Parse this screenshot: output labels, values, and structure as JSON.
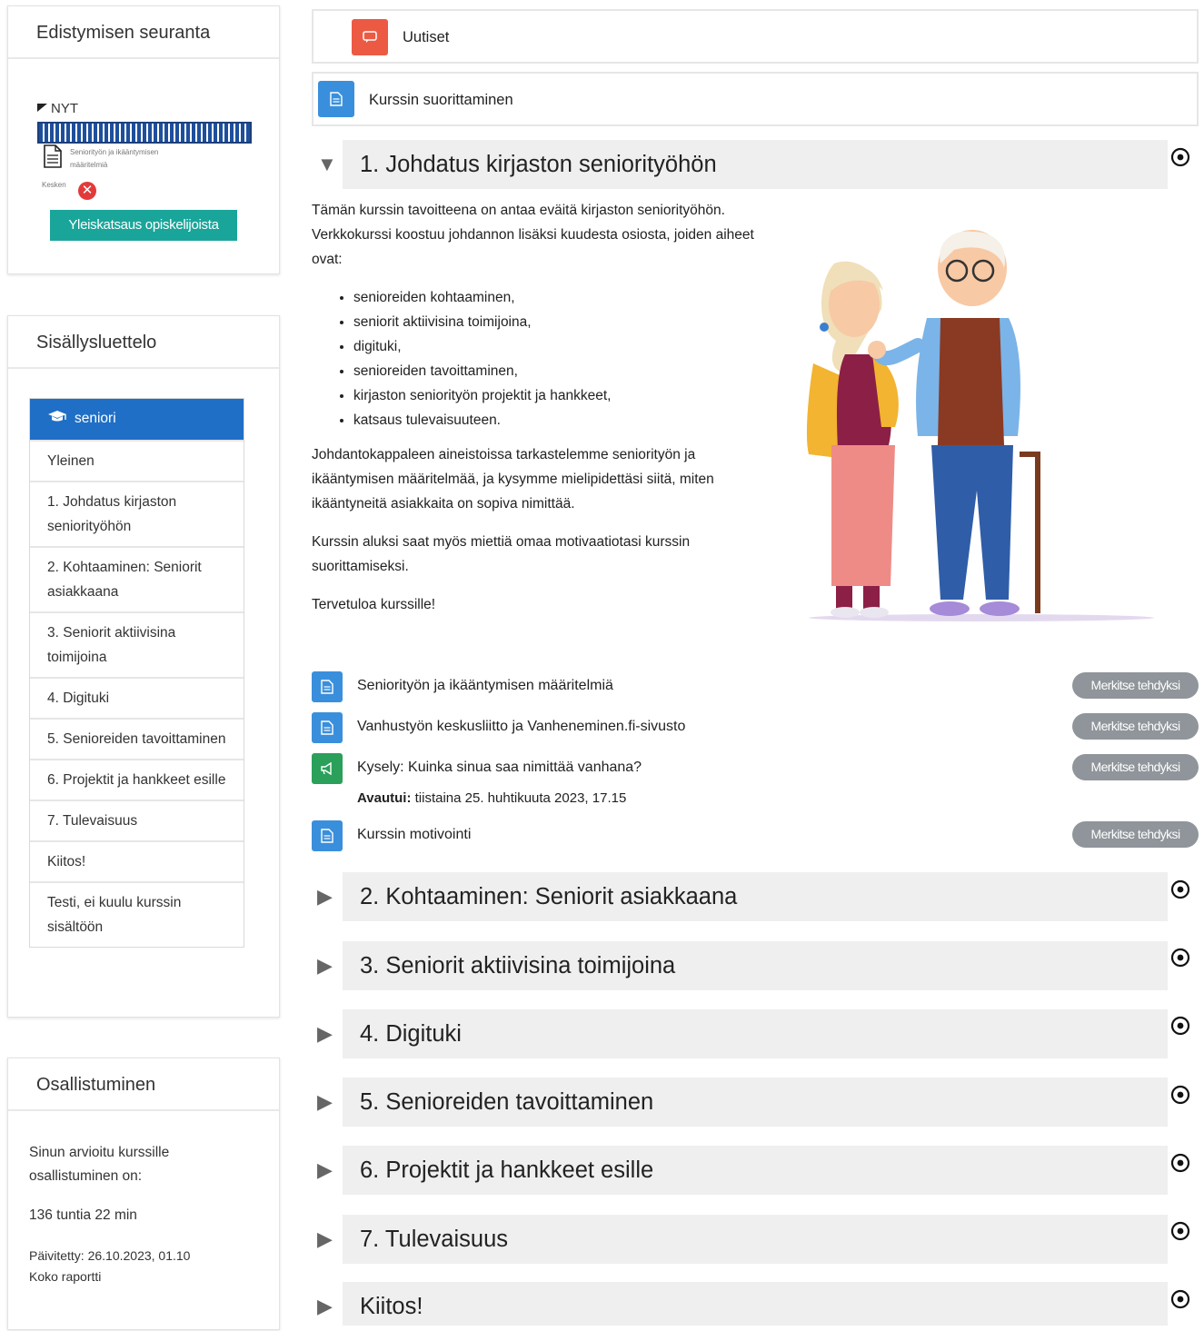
{
  "progress": {
    "title": "Edistymisen seuranta",
    "now_label": "NYT",
    "progress_fraction": 1.0,
    "item_label_line1": "Seniorityön ja ikääntymisen",
    "item_label_line2": "määritelmiä",
    "status_label": "Kesken",
    "overview_button": "Yleiskatsaus opiskelijoista"
  },
  "toc": {
    "title": "Sisällysluettelo",
    "course_label": "seniori",
    "items": [
      "Yleinen",
      "1. Johdatus kirjaston seniorityöhön",
      "2. Kohtaaminen: Seniorit asiakkaana",
      "3. Seniorit aktiivisina toimijoina",
      "4. Digituki",
      "5. Senioreiden tavoittaminen",
      "6. Projektit ja hankkeet esille",
      "7. Tulevaisuus",
      "Kiitos!",
      "Testi, ei kuulu kurssin sisältöön"
    ]
  },
  "participation": {
    "title": "Osallistuminen",
    "text": "Sinun arvioitu kurssille osallistuminen on:",
    "time": "136 tuntia 22 min",
    "updated": "Päivitetty: 26.10.2023, 01.10",
    "report_link": "Koko raportti"
  },
  "top_links": {
    "news": "Uutiset",
    "completion": "Kurssin suorittaminen"
  },
  "section1": {
    "title": "1. Johdatus kirjaston seniorityöhön",
    "intro": "Tämän kurssin tavoitteena on antaa eväitä kirjaston seniorityöhön. Verkkokurssi koostuu johdannon lisäksi kuudesta osiosta, joiden aiheet ovat:",
    "topics": [
      "senioreiden kohtaaminen,",
      "seniorit aktiivisina toimijoina,",
      "digituki,",
      "senioreiden tavoittaminen,",
      "kirjaston seniorityön projektit ja hankkeet,",
      "katsaus tulevaisuuteen."
    ],
    "para2": "Johdantokappaleen aineistoissa tarkastelemme seniorityön ja ikääntymisen määritelmää, ja kysymme mielipidettäsi siitä, miten ikääntyneitä asiakkaita on sopiva nimittää.",
    "para3": "Kurssin aluksi saat myös miettiä omaa motivaatiotasi kurssin suorittamiseksi.",
    "para4": "Tervetuloa kurssille!",
    "activities": [
      {
        "label": "Seniorityön ja ikääntymisen määritelmiä",
        "icon": "page-icon",
        "button": "Merkitse tehdyksi"
      },
      {
        "label": "Vanhustyön keskusliitto ja Vanheneminen.fi-sivusto",
        "icon": "page-icon",
        "button": "Merkitse tehdyksi"
      },
      {
        "label": "Kysely: Kuinka sinua saa nimittää vanhana?",
        "icon": "feedback-icon",
        "button": "Merkitse tehdyksi"
      },
      {
        "label": "Kurssin motivointi",
        "icon": "page-icon",
        "button": "Merkitse tehdyksi"
      }
    ],
    "opens_label": "Avautui:",
    "opens_value": "tiistaina 25. huhtikuuta 2023, 17.15"
  },
  "sections": [
    "2. Kohtaaminen: Seniorit asiakkaana",
    "3. Seniorit aktiivisina toimijoina",
    "4. Digituki",
    "5. Senioreiden tavoittaminen",
    "6. Projektit ja hankkeet esille",
    "7. Tulevaisuus",
    "Kiitos!"
  ],
  "colors": {
    "primary": "#1f6fc6",
    "teal_button": "#1aa59a",
    "news_icon": "#ec5a44",
    "page_icon": "#3a8fdc",
    "feedback_icon": "#2aa05a",
    "done_button": "#8f959a",
    "status_incomplete": "#e23a3a"
  }
}
